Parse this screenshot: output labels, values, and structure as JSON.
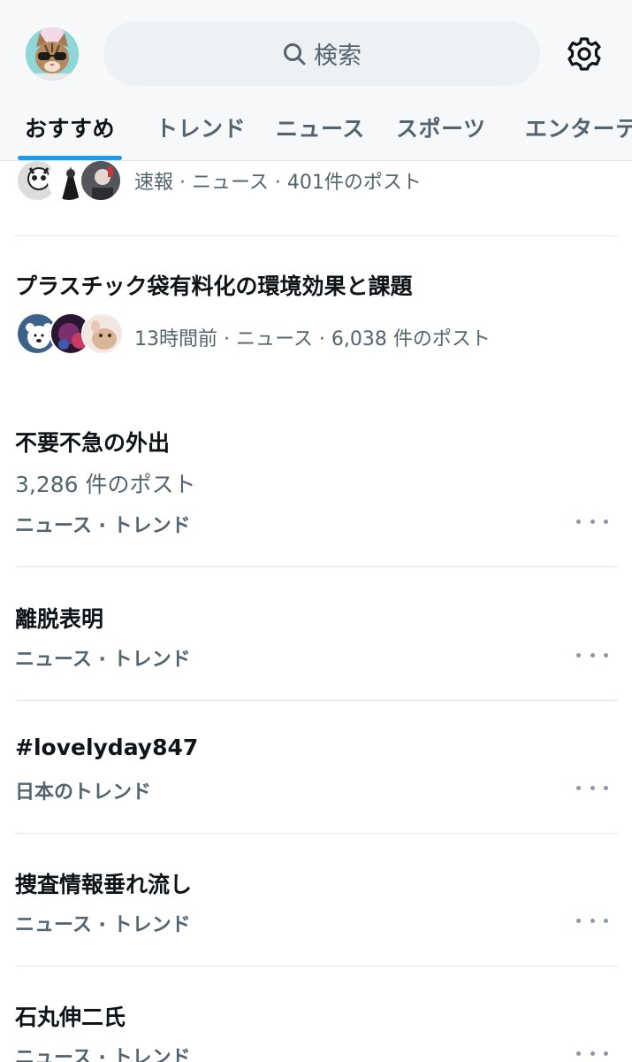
{
  "header": {
    "search_placeholder": "検索",
    "tabs": [
      {
        "label": "おすすめ",
        "active": true
      },
      {
        "label": "トレンド",
        "active": false
      },
      {
        "label": "ニュース",
        "active": false
      },
      {
        "label": "スポーツ",
        "active": false
      },
      {
        "label": "エンターテ",
        "active": false
      }
    ],
    "accent_color": "#1d9bf0"
  },
  "feed": {
    "top_item": {
      "meta": "速報 · ニュース · 401件のポスト"
    },
    "news_item": {
      "title": "プラスチック袋有料化の環境効果と課題",
      "meta": "13時間前 · ニュース · 6,038 件のポスト"
    },
    "trends": [
      {
        "title": "不要不急の外出",
        "count": "3,286 件のポスト",
        "category": "ニュース · トレンド"
      },
      {
        "title": "離脱表明",
        "category": "ニュース · トレンド"
      },
      {
        "title": "#lovelyday847",
        "category": "日本のトレンド"
      },
      {
        "title": "捜査情報垂れ流し",
        "category": "ニュース · トレンド"
      },
      {
        "title": "石丸伸二氏",
        "category": "ニュース · トレンド"
      }
    ]
  },
  "icons": {
    "profile_avatar": "cat-with-sunglasses-avatar",
    "search": "search-icon",
    "settings": "gear-icon",
    "more": "more-horizontal-icon"
  }
}
